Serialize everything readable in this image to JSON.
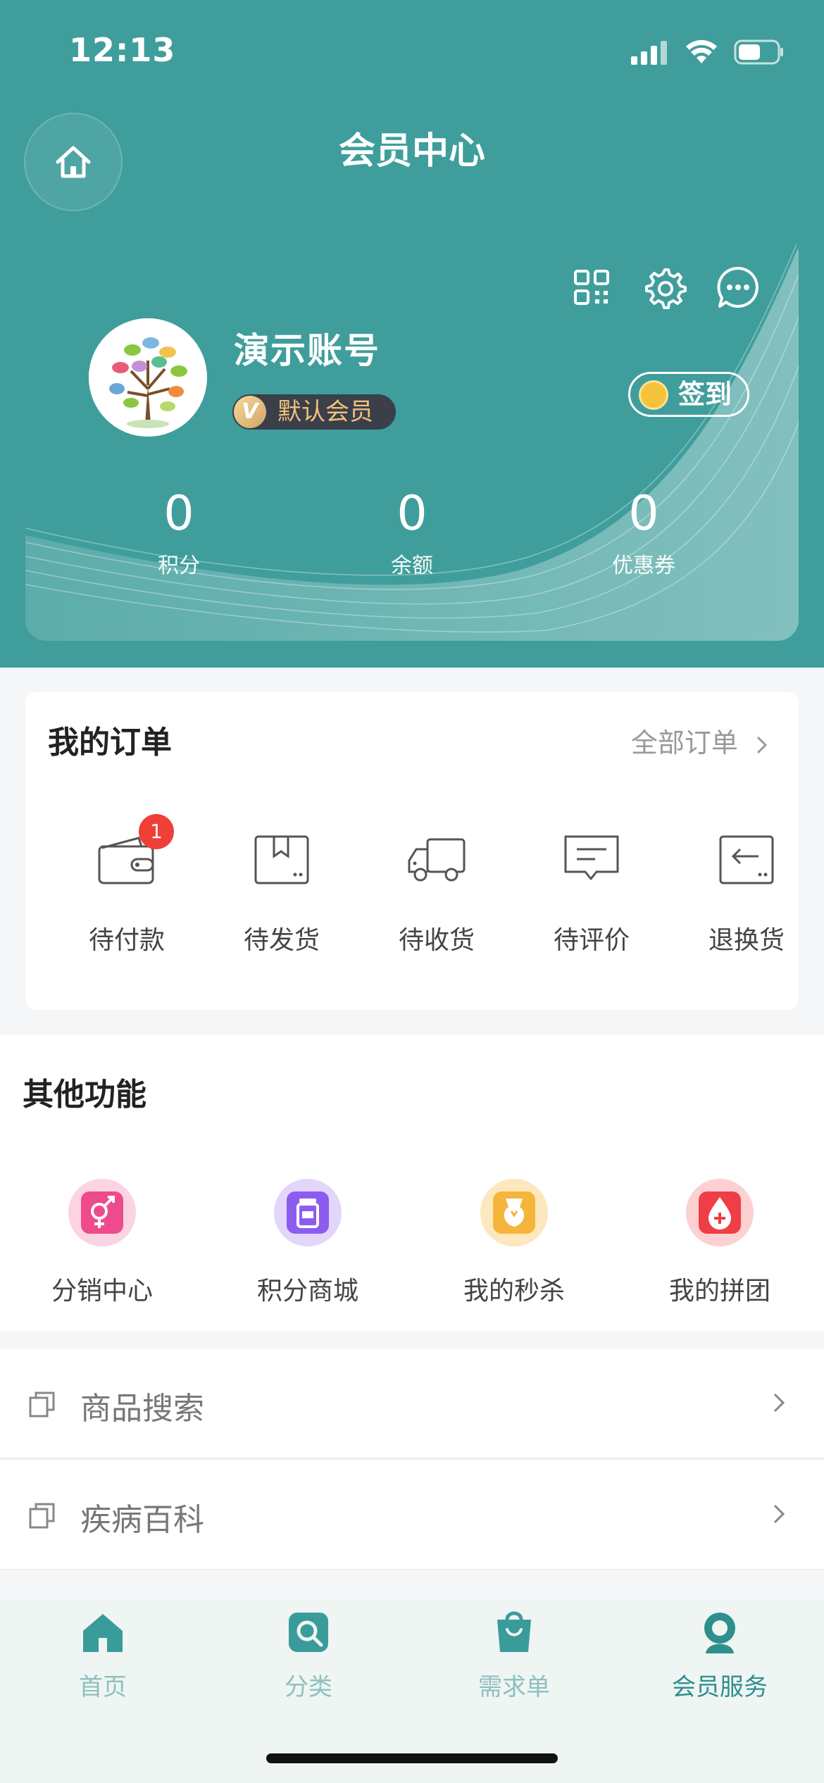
{
  "status_bar": {
    "time": "12:13"
  },
  "nav": {
    "title": "会员中心"
  },
  "profile": {
    "username": "演示账号",
    "member_level": "默认会员",
    "member_level_icon_letter": "V",
    "signin_label": "签到"
  },
  "stats": [
    {
      "value": "0",
      "label": "积分"
    },
    {
      "value": "0",
      "label": "余额"
    },
    {
      "value": "0",
      "label": "优惠券"
    }
  ],
  "orders": {
    "title": "我的订单",
    "all_label": "全部订单",
    "items": [
      {
        "label": "待付款",
        "icon": "wallet-icon",
        "badge": "1"
      },
      {
        "label": "待发货",
        "icon": "package-icon"
      },
      {
        "label": "待收货",
        "icon": "truck-icon"
      },
      {
        "label": "待评价",
        "icon": "comment-icon"
      },
      {
        "label": "退换货",
        "icon": "return-icon"
      }
    ]
  },
  "others": {
    "title": "其他功能",
    "items": [
      {
        "label": "分销中心",
        "icon": "gender-icon",
        "color": "#ee4b8c"
      },
      {
        "label": "积分商城",
        "icon": "jar-icon",
        "color": "#8c5cf0"
      },
      {
        "label": "我的秒杀",
        "icon": "vase-icon",
        "color": "#f5b53b"
      },
      {
        "label": "我的拼团",
        "icon": "blood-drop-icon",
        "color": "#ef3e45"
      }
    ]
  },
  "list": [
    {
      "label": "商品搜索"
    },
    {
      "label": "疾病百科"
    }
  ],
  "tabbar": [
    {
      "label": "首页",
      "icon": "home-tab-icon"
    },
    {
      "label": "分类",
      "icon": "search-tab-icon"
    },
    {
      "label": "需求单",
      "icon": "bag-tab-icon"
    },
    {
      "label": "会员服务",
      "icon": "member-tab-icon",
      "active": true
    }
  ],
  "colors": {
    "brand_teal": "#3f9e9c",
    "badge_red": "#ef3f37",
    "tab_active": "#2f8f8d"
  }
}
